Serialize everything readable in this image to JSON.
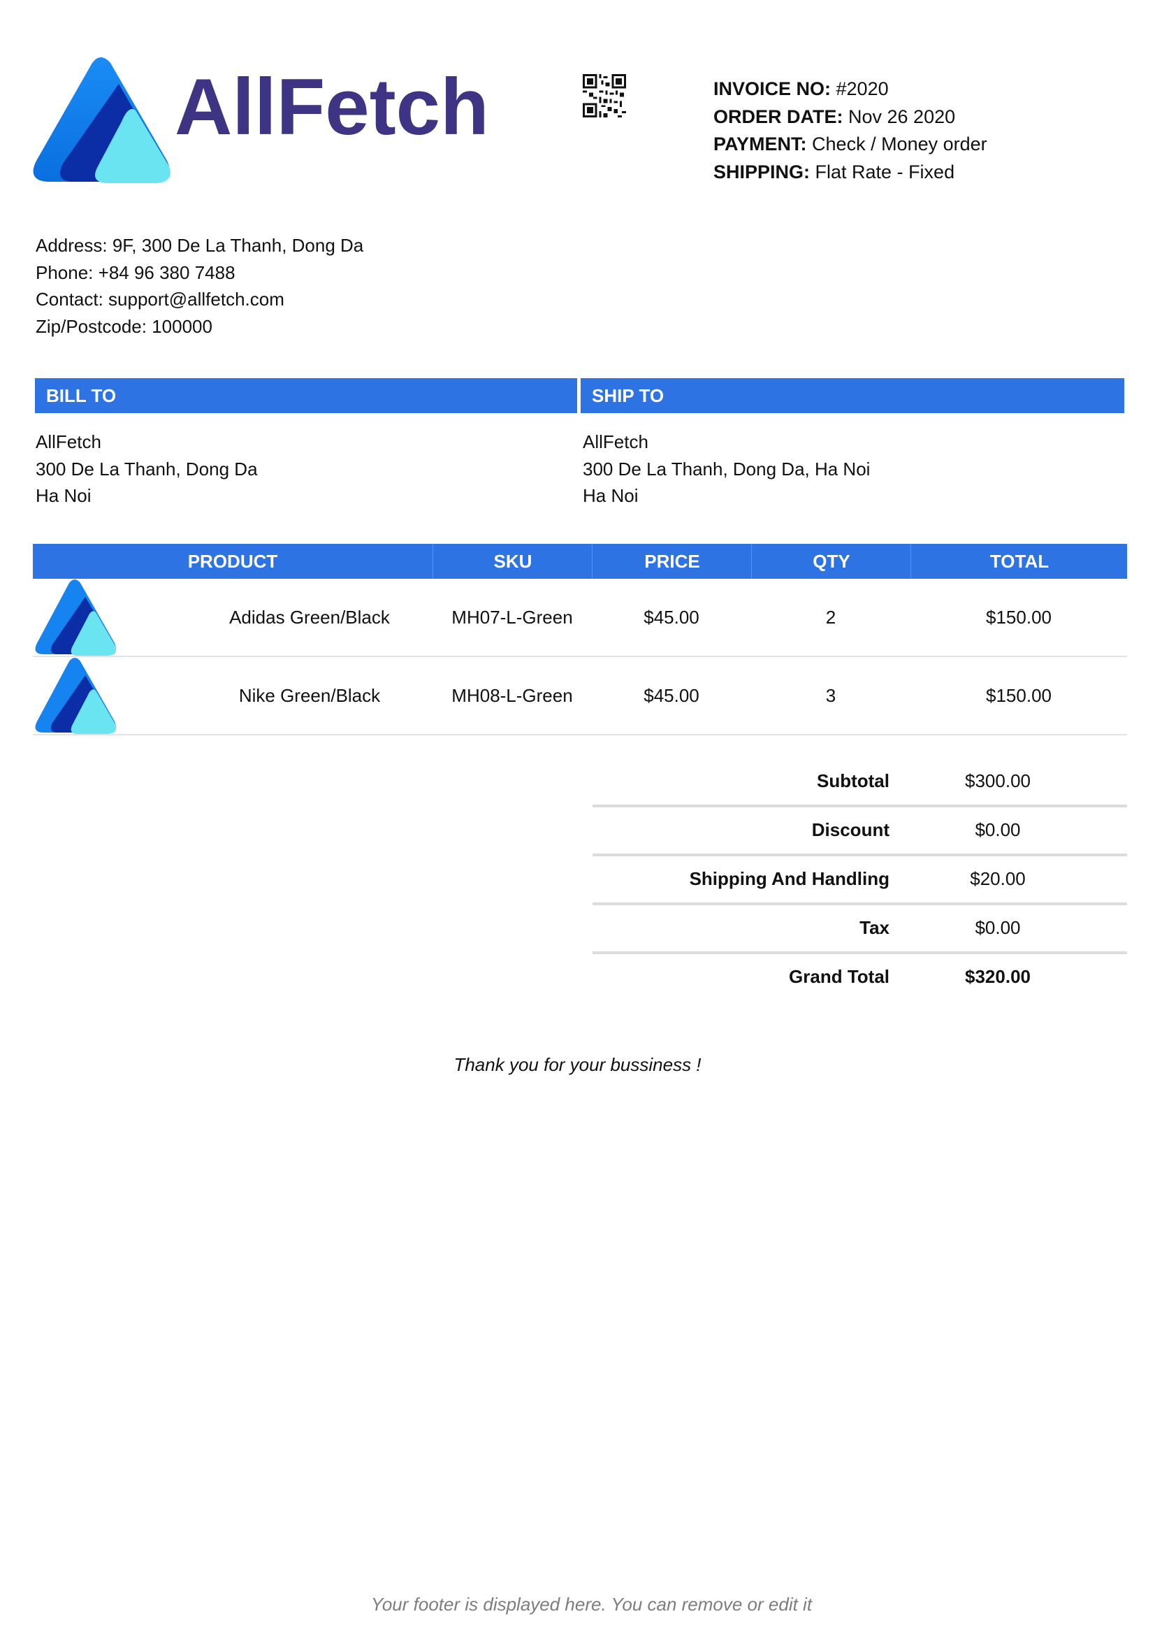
{
  "brand": {
    "name": "AllFetch",
    "logo_icon": "triangle-logo-icon",
    "colors": {
      "primary": "#2e73e4",
      "brand_text": "#3d3484",
      "logo_light": "#6be4f2",
      "logo_dark": "#0d2fa8"
    }
  },
  "qr_icon": "qr-code-icon",
  "invoice_meta": [
    {
      "key": "INVOICE NO:",
      "value": " #2020"
    },
    {
      "key": "ORDER DATE:",
      "value": " Nov 26 2020"
    },
    {
      "key": "PAYMENT:",
      "value": " Check / Money order"
    },
    {
      "key": "SHIPPING:",
      "value": " Flat Rate - Fixed"
    }
  ],
  "company_info": [
    "Address: 9F, 300 De La Thanh, Dong Da",
    "Phone: +84 96 380 7488",
    "Contact: support@allfetch.com",
    "Zip/Postcode: 100000"
  ],
  "bill_to": {
    "heading": "BILL TO",
    "lines": [
      "AllFetch",
      "300 De La Thanh, Dong Da",
      "Ha Noi"
    ]
  },
  "ship_to": {
    "heading": "SHIP TO",
    "lines": [
      "AllFetch",
      "300 De La Thanh, Dong Da, Ha Noi",
      "Ha Noi"
    ]
  },
  "table": {
    "columns": [
      "PRODUCT",
      "SKU",
      "PRICE",
      "QTY",
      "TOTAL"
    ],
    "rows": [
      {
        "product": "Adidas Green/Black",
        "sku": "MH07-L-Green",
        "price": "$45.00",
        "qty": "2",
        "total": "$150.00"
      },
      {
        "product": "Nike Green/Black",
        "sku": "MH08-L-Green",
        "price": "$45.00",
        "qty": "3",
        "total": "$150.00"
      }
    ]
  },
  "totals": [
    {
      "label": "Subtotal",
      "value": "$300.00"
    },
    {
      "label": "Discount",
      "value": "$0.00"
    },
    {
      "label": "Shipping And Handling",
      "value": "$20.00"
    },
    {
      "label": "Tax",
      "value": "$0.00"
    },
    {
      "label": "Grand Total",
      "value": "$320.00"
    }
  ],
  "thanks": "Thank you for your bussiness !",
  "footer": "Your footer is displayed here. You can remove or edit it"
}
